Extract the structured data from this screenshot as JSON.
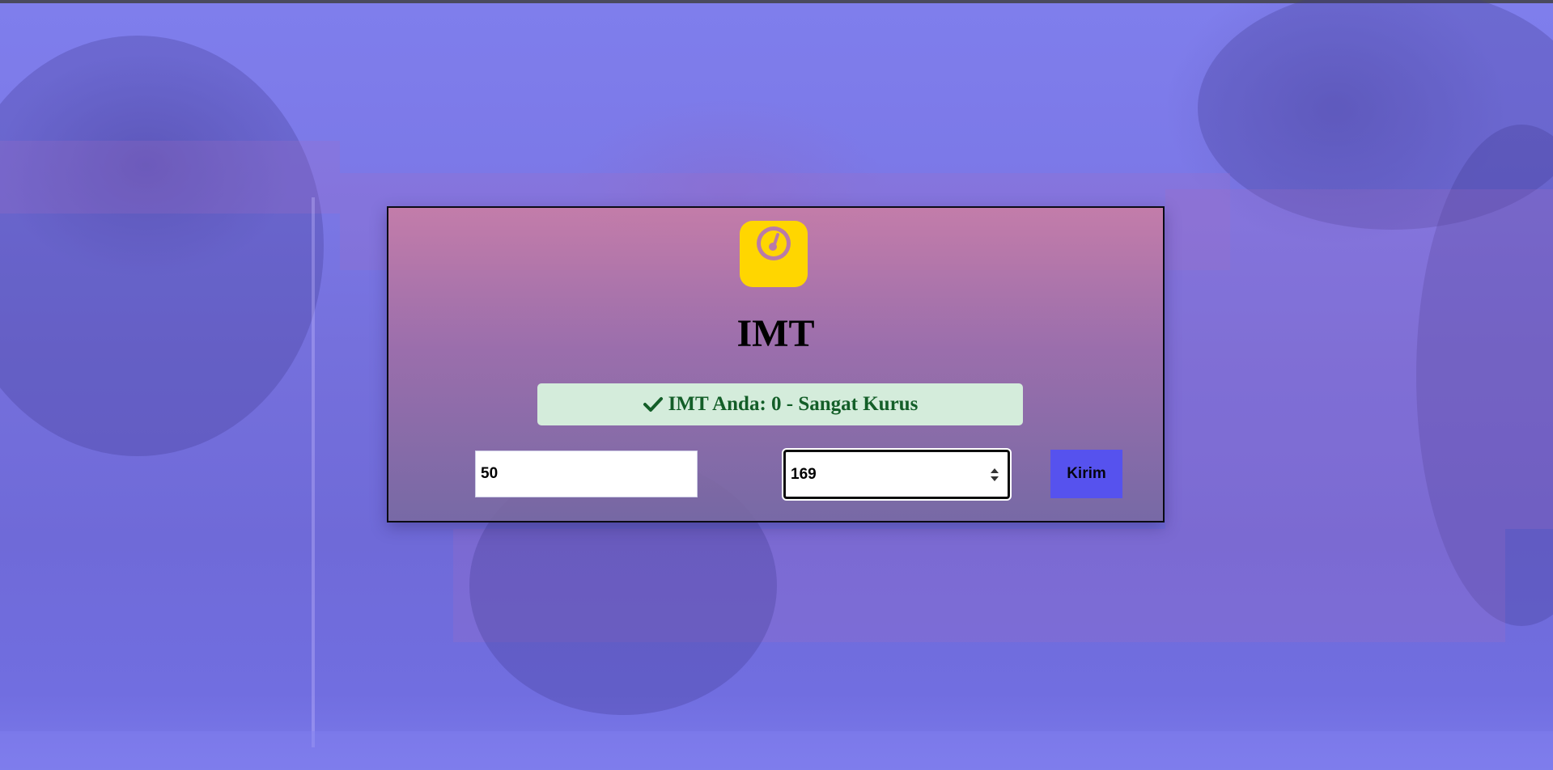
{
  "app": {
    "title": "IMT",
    "icon": "scale-icon",
    "colors": {
      "background": "#7b78ea",
      "icon": "#ffd600",
      "alert_bg": "#d4ecdb",
      "alert_text": "#135e28",
      "button_bg": "#5652ee"
    }
  },
  "result": {
    "icon": "check-icon",
    "message": "IMT Anda: 0 - Sangat Kurus"
  },
  "form": {
    "weight_value": "50",
    "height_value": "169",
    "submit_label": "Kirim"
  }
}
